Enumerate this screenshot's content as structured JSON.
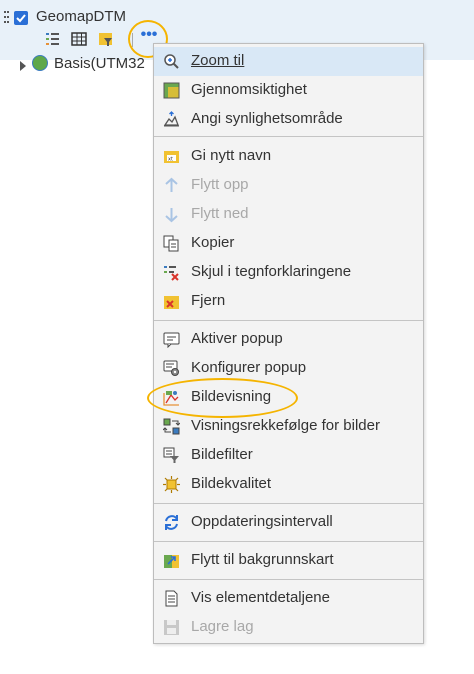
{
  "layer": {
    "title": "GeomapDTM",
    "checked": true,
    "tools": [
      "legend-icon",
      "table-icon",
      "filter-icon",
      "more-options-icon"
    ],
    "more_label": "•••"
  },
  "basis": {
    "label": "Basis(UTM32"
  },
  "menu": {
    "items": [
      {
        "label": "Zoom til",
        "icon": "zoom-icon"
      },
      {
        "label": "Gjennomsiktighet",
        "icon": "transparency-icon"
      },
      {
        "label": "Angi synlighetsområde",
        "icon": "visibility-range-icon"
      },
      {
        "label": "Gi nytt navn",
        "icon": "rename-icon"
      },
      {
        "label": "Flytt opp",
        "icon": "arrow-up-icon"
      },
      {
        "label": "Flytt ned",
        "icon": "arrow-down-icon"
      },
      {
        "label": "Kopier",
        "icon": "copy-icon"
      },
      {
        "label": "Skjul i tegnforklaringene",
        "icon": "hide-legend-icon"
      },
      {
        "label": "Fjern",
        "icon": "remove-icon"
      },
      {
        "label": "Aktiver popup",
        "icon": "popup-icon"
      },
      {
        "label": "Konfigurer popup",
        "icon": "configure-popup-icon"
      },
      {
        "label": "Bildevisning",
        "icon": "image-display-icon"
      },
      {
        "label": "Visningsrekkefølge for bilder",
        "icon": "image-order-icon"
      },
      {
        "label": "Bildefilter",
        "icon": "image-filter-icon"
      },
      {
        "label": "Bildekvalitet",
        "icon": "image-quality-icon"
      },
      {
        "label": "Oppdateringsintervall",
        "icon": "refresh-icon"
      },
      {
        "label": "Flytt til bakgrunnskart",
        "icon": "basemap-icon"
      },
      {
        "label": "Vis elementdetaljene",
        "icon": "document-icon"
      },
      {
        "label": "Lagre lag",
        "icon": "save-icon"
      }
    ]
  },
  "colors": {
    "accent": "#2a6fd6",
    "highlight": "#f5b400",
    "selected_bg": "#d9e8f6"
  }
}
